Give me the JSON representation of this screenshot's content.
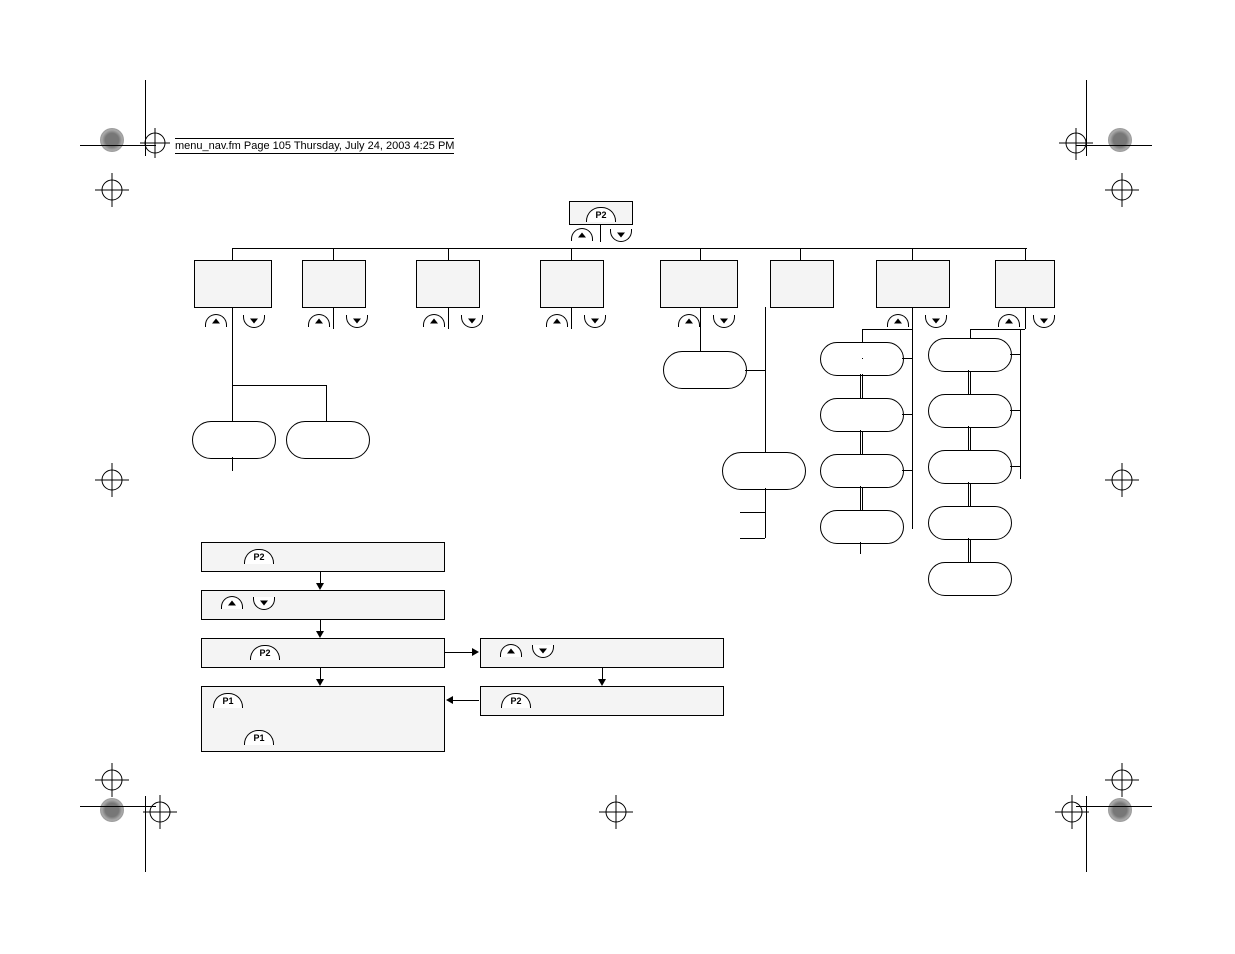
{
  "header": {
    "text": "menu_nav.fm  Page 105  Thursday, July 24, 2003  4:25 PM"
  },
  "p_labels": {
    "top": "P2",
    "step1": "P2",
    "step3": "P2",
    "step4a": "P1",
    "step4b": "P1",
    "step5": "P2"
  }
}
